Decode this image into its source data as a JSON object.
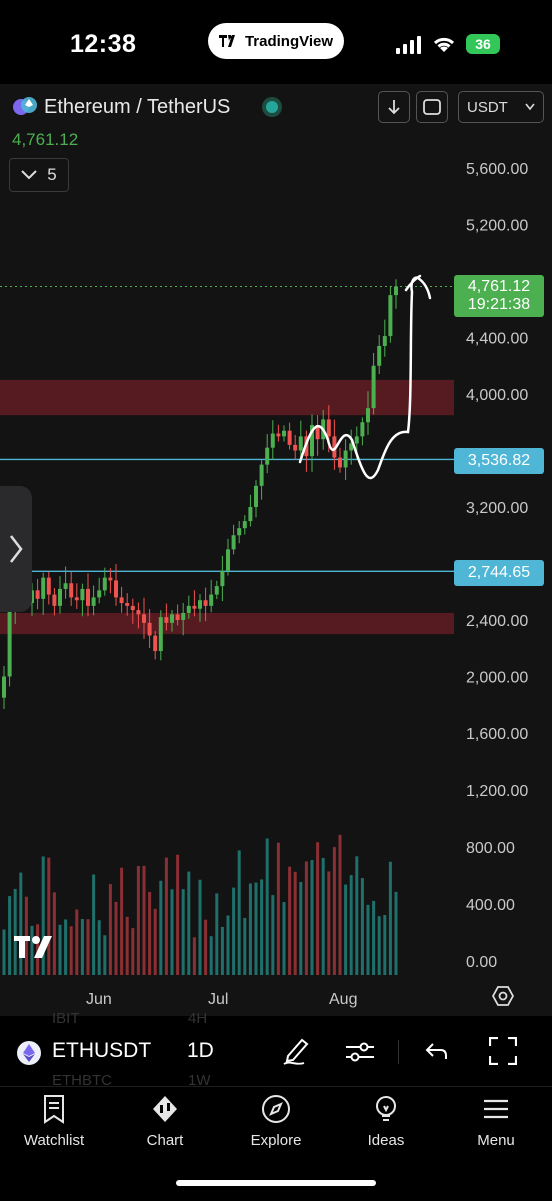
{
  "status_bar": {
    "time": "12:38",
    "app_pill": "TradingView",
    "battery": "36"
  },
  "header": {
    "pair_title": "Ethereum / TetherUS",
    "last_price": "4,761.12",
    "interval_count": "5",
    "currency": "USDT"
  },
  "price_tags": {
    "current_price": "4,761.12",
    "countdown": "19:21:38",
    "level_1": "3,536.82",
    "level_2": "2,744.65"
  },
  "colors": {
    "up": "#26a69a",
    "down": "#ef5350",
    "bull_candle": "#4caf50",
    "line": "#4fb6d6",
    "zone": "#6e1f26",
    "price_tag": "#4caf50"
  },
  "chart_data": {
    "type": "candlestick",
    "title": "",
    "y_axis": {
      "ticks": [
        "5,600.00",
        "5,200.00",
        "4,400.00",
        "4,000.00",
        "3,200.00",
        "2,400.00",
        "2,000.00"
      ]
    },
    "volume_axis": {
      "ticks": [
        "1,600.00",
        "1,200.00",
        "800.00",
        "400.00",
        "0.00"
      ]
    },
    "x_axis": {
      "ticks": [
        "Jun",
        "Jul",
        "Aug"
      ]
    },
    "horizontal_lines": [
      3536.82,
      2744.65
    ],
    "zones": [
      [
        3850,
        4100
      ],
      [
        2300,
        2450
      ]
    ],
    "current_price": 4761.12,
    "approx_closes": [
      2000,
      2480,
      2560,
      2600,
      2520,
      2610,
      2550,
      2700,
      2580,
      2500,
      2620,
      2660,
      2560,
      2540,
      2620,
      2500,
      2560,
      2610,
      2700,
      2680,
      2560,
      2520,
      2500,
      2470,
      2440,
      2380,
      2290,
      2180,
      2420,
      2380,
      2440,
      2400,
      2450,
      2500,
      2480,
      2540,
      2500,
      2580,
      2640,
      2750,
      2900,
      3000,
      3050,
      3100,
      3200,
      3350,
      3500,
      3620,
      3720,
      3700,
      3740,
      3640,
      3600,
      3700,
      3560,
      3780,
      3680,
      3820,
      3700,
      3550,
      3480,
      3600,
      3650,
      3700,
      3800,
      3900,
      4200,
      4340,
      4410,
      4700,
      4761
    ]
  },
  "toolbar": {
    "ticker": "ETHUSDT",
    "interval": "1D",
    "ghost_1": "IBIT",
    "ghost_2": "4H",
    "ghost_3": "ETHBTC",
    "ghost_4": "1W"
  },
  "tabs": [
    {
      "label": "Watchlist"
    },
    {
      "label": "Chart"
    },
    {
      "label": "Explore"
    },
    {
      "label": "Ideas"
    },
    {
      "label": "Menu"
    }
  ]
}
